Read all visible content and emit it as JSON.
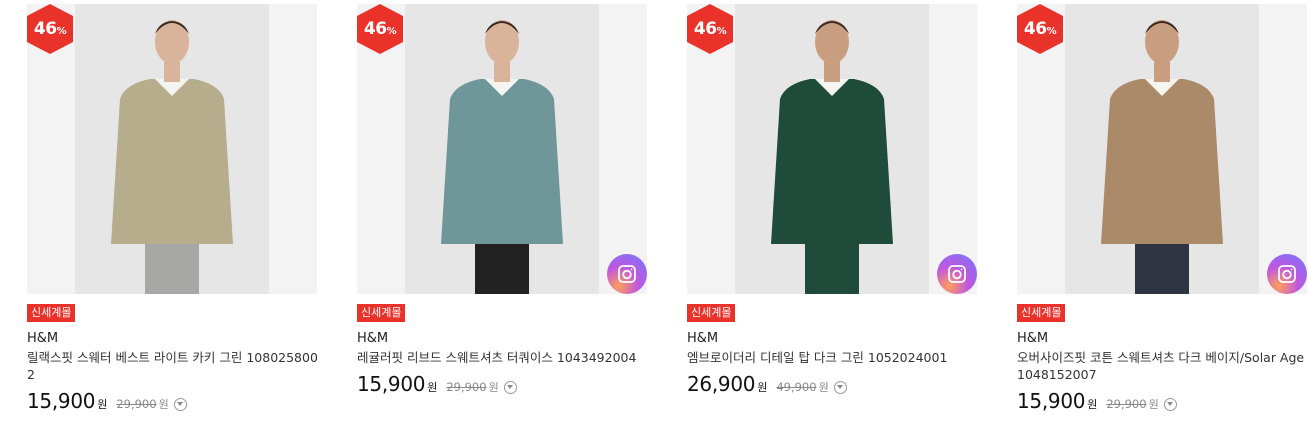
{
  "products": [
    {
      "discount": "46",
      "discount_unit": "%",
      "tag": "신세계몰",
      "brand": "H&M",
      "name": "릴랙스핏 스웨터 베스트 라이트 카키 그린 1080258002",
      "price": "15,900",
      "currency": "원",
      "original_price": "29,900",
      "has_review_icon": false,
      "colors": {
        "top": "#b6ad8c",
        "inner": "#f4f4f0",
        "bottom": "#a7a7a5",
        "skin": "#d9b39a"
      }
    },
    {
      "discount": "46",
      "discount_unit": "%",
      "tag": "신세계몰",
      "brand": "H&M",
      "name": "레귤러핏 리브드 스웨트셔츠 터쿼이스 1043492004",
      "price": "15,900",
      "currency": "원",
      "original_price": "29,900",
      "has_review_icon": true,
      "colors": {
        "top": "#6f9699",
        "inner": "#f4f4f0",
        "bottom": "#222222",
        "skin": "#d9b39a"
      }
    },
    {
      "discount": "46",
      "discount_unit": "%",
      "tag": "신세계몰",
      "brand": "H&M",
      "name": "엠브로이더리 디테일 탑 다크 그린 1052024001",
      "price": "26,900",
      "currency": "원",
      "original_price": "49,900",
      "has_review_icon": true,
      "colors": {
        "top": "#1f4b3a",
        "inner": "#f4f4f0",
        "bottom": "#1f4b3a",
        "skin": "#c99d80"
      }
    },
    {
      "discount": "46",
      "discount_unit": "%",
      "tag": "신세계몰",
      "brand": "H&M",
      "name": "오버사이즈핏 코튼 스웨트셔츠 다크 베이지/Solar Age 1048152007",
      "price": "15,900",
      "currency": "원",
      "original_price": "29,900",
      "has_review_icon": true,
      "colors": {
        "top": "#ab8a69",
        "inner": "#f4f4f0",
        "bottom": "#2e3442",
        "skin": "#c99d80"
      }
    }
  ],
  "icons": {
    "badge": "discount-badge-icon",
    "review": "photo-review-icon",
    "info": "price-info-icon"
  },
  "accent": "#e8322a"
}
